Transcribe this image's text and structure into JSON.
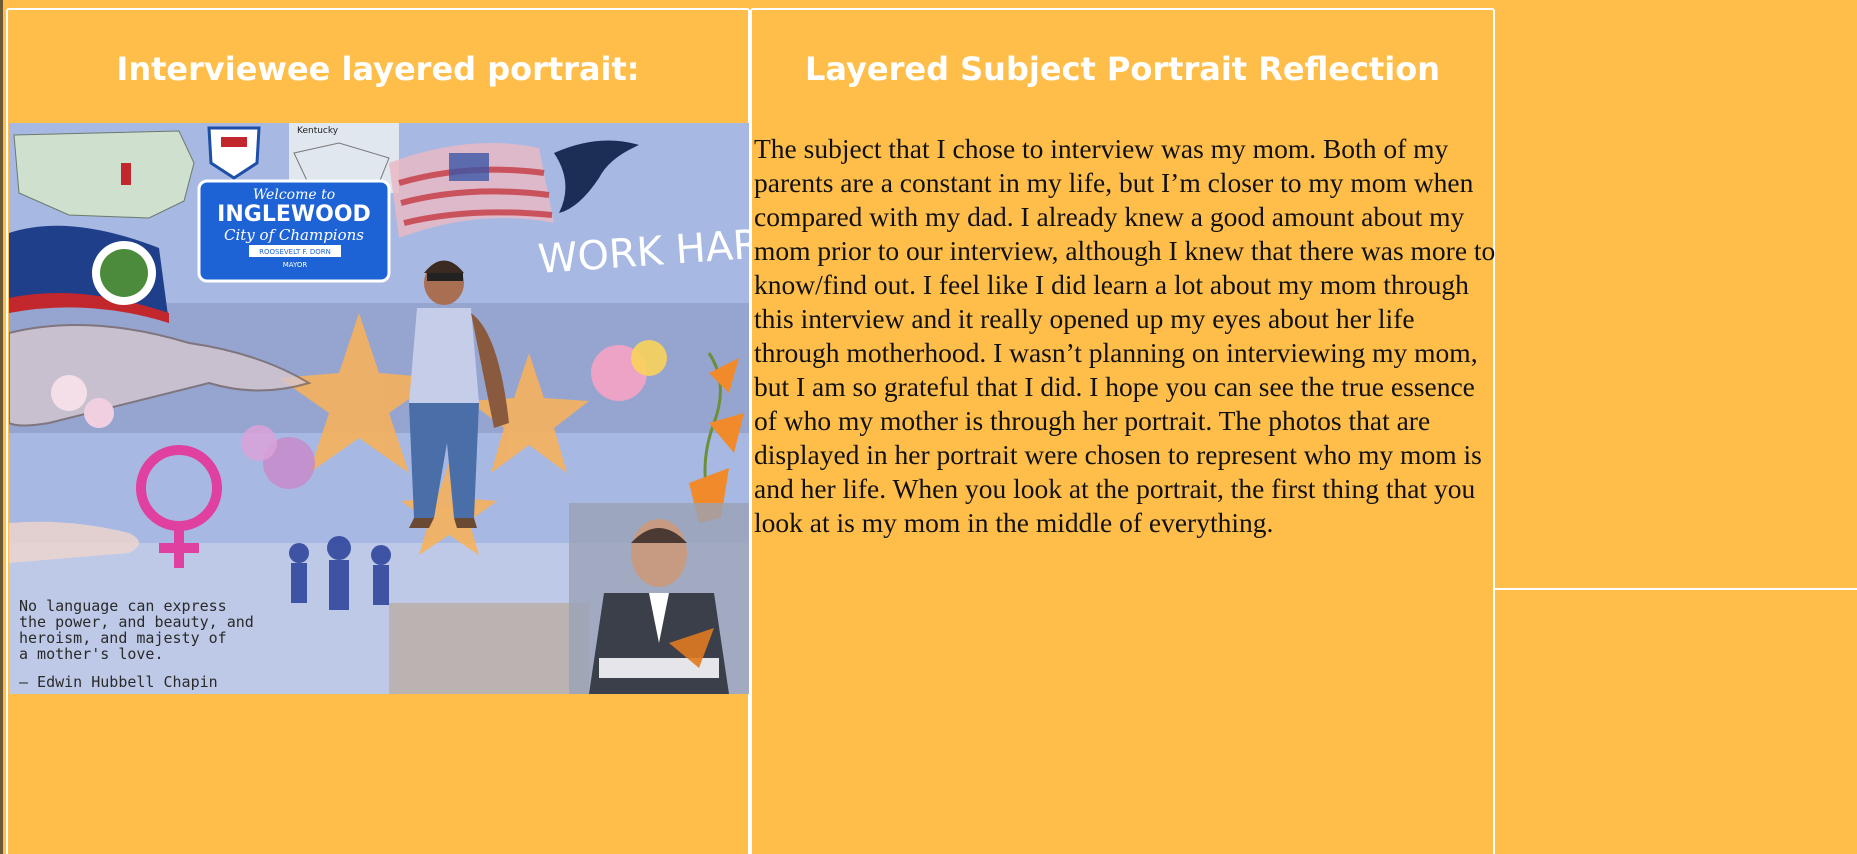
{
  "left_panel": {
    "title": "Interviewee layered portrait:",
    "portrait": {
      "sign_welcome": "Welcome to",
      "sign_city": "INGLEWOOD",
      "sign_slogan": "City of Champions",
      "sign_mayor_name": "ROOSEVELT F. DORN",
      "sign_mayor_title": "MAYOR",
      "map_label": "Kentucky",
      "overlay_text": "WORK HARDER",
      "quote_lines": [
        "No language can express",
        "the power, and beauty, and",
        "heroism, and majesty of",
        "a mother's love."
      ],
      "quote_author": "— Edwin Hubbell Chapin"
    }
  },
  "middle_panel": {
    "title": "Layered Subject Portrait Reflection",
    "body": "The subject that I chose to interview was my mom. Both of my parents are a constant in my life, but I’m closer to my mom when compared with my dad. I already knew a good amount about my mom prior to our interview, although I knew that there was more to know/find out. I feel like I did learn a lot about my mom through this interview and it really opened up my eyes about her life through motherhood. I wasn’t planning on interviewing my mom, but I am so grateful that I did. I hope you can see the true essence of who my mother is through her portrait. The photos that are displayed in her portrait were chosen to represent who my mom is and her life. When you look at the portrait, the first thing that you look at is my mom in the middle of everything."
  },
  "colors": {
    "page_background": "#FFBE4A",
    "panel_border": "#FFFFFF",
    "title_text": "#FFFFFF",
    "body_text": "#111111"
  }
}
